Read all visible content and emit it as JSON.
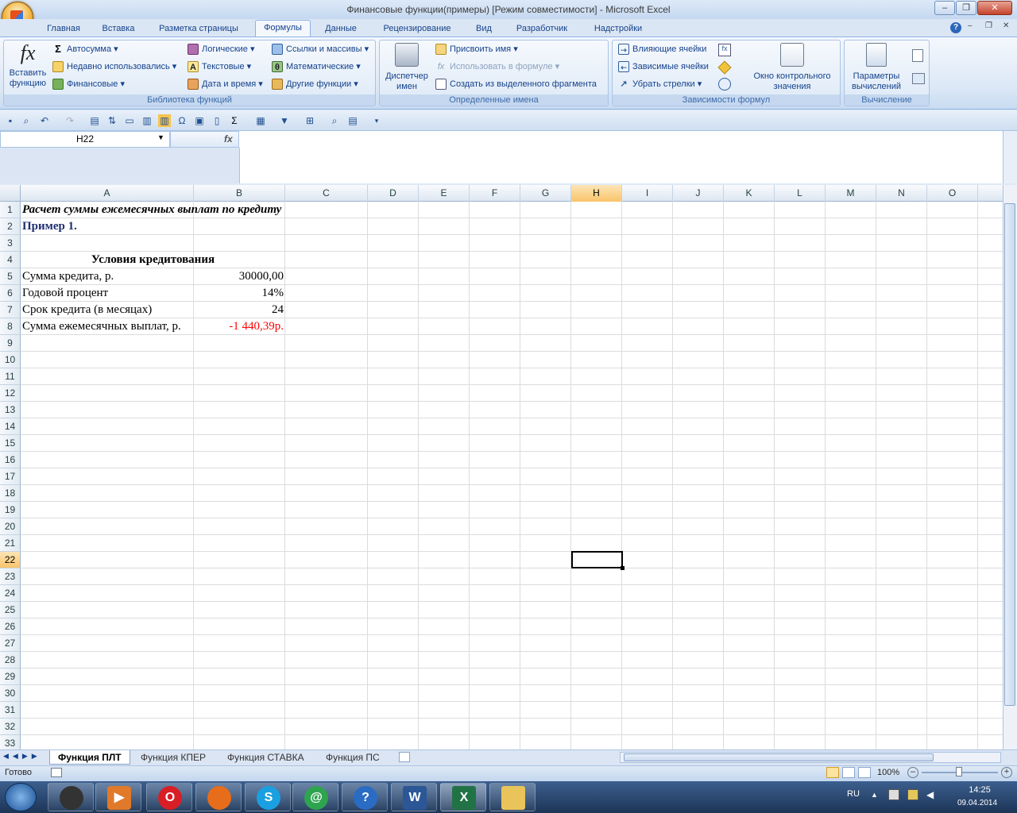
{
  "window": {
    "title": "Финансовые функции(примеры)  [Режим совместимости] - Microsoft Excel"
  },
  "tabs": [
    "Главная",
    "Вставка",
    "Разметка страницы",
    "Формулы",
    "Данные",
    "Рецензирование",
    "Вид",
    "Разработчик",
    "Надстройки"
  ],
  "ribbon": {
    "insert_function": "Вставить функцию",
    "library": {
      "label": "Библиотека функций",
      "autosum": "Автосумма",
      "recent": "Недавно использовались",
      "financial": "Финансовые",
      "logical": "Логические",
      "text": "Текстовые",
      "datetime": "Дата и время",
      "lookup": "Ссылки и массивы",
      "math": "Математические",
      "other": "Другие функции"
    },
    "names": {
      "label": "Определенные имена",
      "manager": "Диспетчер имен",
      "define": "Присвоить имя",
      "use_in_formula": "Использовать в формуле",
      "create": "Создать из выделенного фрагмента"
    },
    "auditing": {
      "label": "Зависимости формул",
      "precedents": "Влияющие ячейки",
      "dependents": "Зависимые ячейки",
      "remove_arrows": "Убрать стрелки",
      "watch": "Окно контрольного значения"
    },
    "calc": {
      "label": "Вычисление",
      "options": "Параметры вычислений"
    }
  },
  "formula_bar": {
    "name_box": "H22",
    "fx": "fx",
    "formula": ""
  },
  "columns": [
    "A",
    "B",
    "C",
    "D",
    "E",
    "F",
    "G",
    "H",
    "I",
    "J",
    "K",
    "L",
    "M",
    "N",
    "O"
  ],
  "selected_cell": "H22",
  "rows": [
    "1",
    "2",
    "3",
    "4",
    "5",
    "6",
    "7",
    "8",
    "9",
    "10",
    "11",
    "12",
    "13",
    "14",
    "15",
    "16",
    "17",
    "18",
    "19",
    "20",
    "21",
    "22",
    "23",
    "24",
    "25",
    "26",
    "27",
    "28",
    "29",
    "30",
    "31",
    "32",
    "33"
  ],
  "cells": {
    "A1": "Расчет суммы ежемесячных выплат по кредиту",
    "A2": "Пример 1.",
    "A4": "Условия кредитования",
    "A5": "Сумма кредита, р.",
    "B5": "30000,00",
    "A6": "Годовой процент",
    "B6": "14%",
    "A7": "Срок кредита (в месяцах)",
    "B7": "24",
    "A8": "Сумма ежемесячных выплат, р.",
    "B8": "-1 440,39р."
  },
  "sheets": [
    "Функция ПЛТ",
    "Функция КПЕР",
    "Функция СТАВКА",
    "Функция ПС"
  ],
  "status": {
    "ready": "Готово",
    "zoom": "100%"
  },
  "taskbar": {
    "lang": "RU",
    "time": "14:25",
    "date": "09.04.2014"
  },
  "colors": {
    "negative": "#ff0000",
    "heading": "#1f2f6f",
    "accent": "#15428b"
  }
}
